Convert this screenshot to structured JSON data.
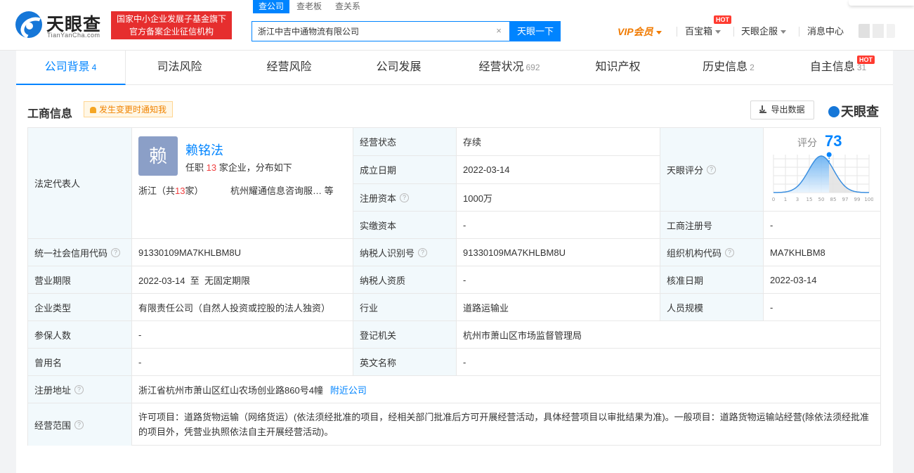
{
  "header": {
    "logo_cn": "天眼查",
    "logo_en": "TianYanCha.com",
    "slogan_line1": "国家中小企业发展子基金旗下",
    "slogan_line2": "官方备案企业征信机构",
    "search_tabs": [
      "查公司",
      "查老板",
      "查关系"
    ],
    "search_value": "浙江中吉中通物流有限公司",
    "search_button": "天眼一下",
    "vip": "VIP会员",
    "baobao": "百宝箱",
    "hot": "HOT",
    "qifu": "天眼企服",
    "messages": "消息中心"
  },
  "tabs": [
    {
      "label": "公司背景",
      "count": "4"
    },
    {
      "label": "司法风险",
      "count": ""
    },
    {
      "label": "经营风险",
      "count": ""
    },
    {
      "label": "公司发展",
      "count": ""
    },
    {
      "label": "经营状况",
      "count": "692"
    },
    {
      "label": "知识产权",
      "count": ""
    },
    {
      "label": "历史信息",
      "count": "2"
    },
    {
      "label": "自主信息",
      "count": "31"
    }
  ],
  "section": {
    "title": "工商信息",
    "notify": "发生变更时通知我",
    "export": "导出数据",
    "brand": "天眼查"
  },
  "rep": {
    "label": "法定代表人",
    "avatar_char": "赖",
    "name": "赖铭法",
    "sub_prefix": "任职 ",
    "sub_count": "13",
    "sub_suffix": " 家企业，分布如下",
    "region_prefix": "浙江（共",
    "region_count": "13",
    "region_suffix": "家）",
    "company": "杭州耀通信息咨询服…  等"
  },
  "score": {
    "label": "天眼评分",
    "title": "评分",
    "value": 73,
    "ticks": [
      "0",
      "1",
      "3",
      "15",
      "50",
      "85",
      "97",
      "99",
      "100"
    ]
  },
  "rows": {
    "status_label": "经营状态",
    "status": "存续",
    "found_label": "成立日期",
    "found": "2022-03-14",
    "capital_label": "注册资本",
    "capital": "1000万",
    "paid_label": "实缴资本",
    "paid": "-",
    "regno_label": "工商注册号",
    "regno": "-",
    "credit_label": "统一社会信用代码",
    "credit": "91330109MA7KHLBM8U",
    "taxid_label": "纳税人识别号",
    "taxid": "91330109MA7KHLBM8U",
    "org_label": "组织机构代码",
    "org": "MA7KHLBM8",
    "term_label": "营业期限",
    "term": "2022-03-14  至  无固定期限",
    "taxq_label": "纳税人资质",
    "taxq": "-",
    "approve_label": "核准日期",
    "approve": "2022-03-14",
    "type_label": "企业类型",
    "type": "有限责任公司（自然人投资或控股的法人独资）",
    "industry_label": "行业",
    "industry": "道路运输业",
    "staff_label": "人员规模",
    "staff": "-",
    "insured_label": "参保人数",
    "insured": "-",
    "authority_label": "登记机关",
    "authority": "杭州市萧山区市场监督管理局",
    "former_label": "曾用名",
    "former": "-",
    "english_label": "英文名称",
    "english": "-",
    "address_label": "注册地址",
    "address": "浙江省杭州市萧山区红山农场创业路860号4幢",
    "nearby": "附近公司",
    "scope_label": "经营范围",
    "scope": "许可项目：道路货物运输（网络货运）(依法须经批准的项目，经相关部门批准后方可开展经营活动，具体经营项目以审批结果为准)。一般项目：道路货物运输站经营(除依法须经批准的项目外，凭营业执照依法自主开展经营活动)。"
  },
  "colors": {
    "accent": "#0084ff",
    "label_bg": "#f2f9fc",
    "red": "#f04141",
    "slogan_bg": "#e62e2e"
  }
}
